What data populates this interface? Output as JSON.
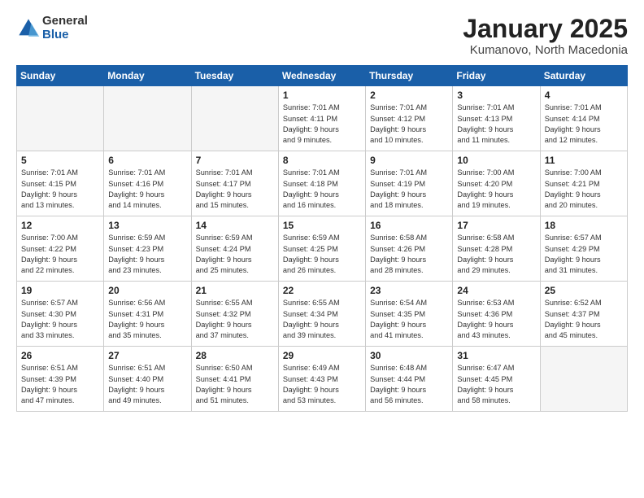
{
  "logo": {
    "general": "General",
    "blue": "Blue"
  },
  "title": "January 2025",
  "subtitle": "Kumanovo, North Macedonia",
  "days_of_week": [
    "Sunday",
    "Monday",
    "Tuesday",
    "Wednesday",
    "Thursday",
    "Friday",
    "Saturday"
  ],
  "weeks": [
    [
      {
        "day": "",
        "info": ""
      },
      {
        "day": "",
        "info": ""
      },
      {
        "day": "",
        "info": ""
      },
      {
        "day": "1",
        "info": "Sunrise: 7:01 AM\nSunset: 4:11 PM\nDaylight: 9 hours\nand 9 minutes."
      },
      {
        "day": "2",
        "info": "Sunrise: 7:01 AM\nSunset: 4:12 PM\nDaylight: 9 hours\nand 10 minutes."
      },
      {
        "day": "3",
        "info": "Sunrise: 7:01 AM\nSunset: 4:13 PM\nDaylight: 9 hours\nand 11 minutes."
      },
      {
        "day": "4",
        "info": "Sunrise: 7:01 AM\nSunset: 4:14 PM\nDaylight: 9 hours\nand 12 minutes."
      }
    ],
    [
      {
        "day": "5",
        "info": "Sunrise: 7:01 AM\nSunset: 4:15 PM\nDaylight: 9 hours\nand 13 minutes."
      },
      {
        "day": "6",
        "info": "Sunrise: 7:01 AM\nSunset: 4:16 PM\nDaylight: 9 hours\nand 14 minutes."
      },
      {
        "day": "7",
        "info": "Sunrise: 7:01 AM\nSunset: 4:17 PM\nDaylight: 9 hours\nand 15 minutes."
      },
      {
        "day": "8",
        "info": "Sunrise: 7:01 AM\nSunset: 4:18 PM\nDaylight: 9 hours\nand 16 minutes."
      },
      {
        "day": "9",
        "info": "Sunrise: 7:01 AM\nSunset: 4:19 PM\nDaylight: 9 hours\nand 18 minutes."
      },
      {
        "day": "10",
        "info": "Sunrise: 7:00 AM\nSunset: 4:20 PM\nDaylight: 9 hours\nand 19 minutes."
      },
      {
        "day": "11",
        "info": "Sunrise: 7:00 AM\nSunset: 4:21 PM\nDaylight: 9 hours\nand 20 minutes."
      }
    ],
    [
      {
        "day": "12",
        "info": "Sunrise: 7:00 AM\nSunset: 4:22 PM\nDaylight: 9 hours\nand 22 minutes."
      },
      {
        "day": "13",
        "info": "Sunrise: 6:59 AM\nSunset: 4:23 PM\nDaylight: 9 hours\nand 23 minutes."
      },
      {
        "day": "14",
        "info": "Sunrise: 6:59 AM\nSunset: 4:24 PM\nDaylight: 9 hours\nand 25 minutes."
      },
      {
        "day": "15",
        "info": "Sunrise: 6:59 AM\nSunset: 4:25 PM\nDaylight: 9 hours\nand 26 minutes."
      },
      {
        "day": "16",
        "info": "Sunrise: 6:58 AM\nSunset: 4:26 PM\nDaylight: 9 hours\nand 28 minutes."
      },
      {
        "day": "17",
        "info": "Sunrise: 6:58 AM\nSunset: 4:28 PM\nDaylight: 9 hours\nand 29 minutes."
      },
      {
        "day": "18",
        "info": "Sunrise: 6:57 AM\nSunset: 4:29 PM\nDaylight: 9 hours\nand 31 minutes."
      }
    ],
    [
      {
        "day": "19",
        "info": "Sunrise: 6:57 AM\nSunset: 4:30 PM\nDaylight: 9 hours\nand 33 minutes."
      },
      {
        "day": "20",
        "info": "Sunrise: 6:56 AM\nSunset: 4:31 PM\nDaylight: 9 hours\nand 35 minutes."
      },
      {
        "day": "21",
        "info": "Sunrise: 6:55 AM\nSunset: 4:32 PM\nDaylight: 9 hours\nand 37 minutes."
      },
      {
        "day": "22",
        "info": "Sunrise: 6:55 AM\nSunset: 4:34 PM\nDaylight: 9 hours\nand 39 minutes."
      },
      {
        "day": "23",
        "info": "Sunrise: 6:54 AM\nSunset: 4:35 PM\nDaylight: 9 hours\nand 41 minutes."
      },
      {
        "day": "24",
        "info": "Sunrise: 6:53 AM\nSunset: 4:36 PM\nDaylight: 9 hours\nand 43 minutes."
      },
      {
        "day": "25",
        "info": "Sunrise: 6:52 AM\nSunset: 4:37 PM\nDaylight: 9 hours\nand 45 minutes."
      }
    ],
    [
      {
        "day": "26",
        "info": "Sunrise: 6:51 AM\nSunset: 4:39 PM\nDaylight: 9 hours\nand 47 minutes."
      },
      {
        "day": "27",
        "info": "Sunrise: 6:51 AM\nSunset: 4:40 PM\nDaylight: 9 hours\nand 49 minutes."
      },
      {
        "day": "28",
        "info": "Sunrise: 6:50 AM\nSunset: 4:41 PM\nDaylight: 9 hours\nand 51 minutes."
      },
      {
        "day": "29",
        "info": "Sunrise: 6:49 AM\nSunset: 4:43 PM\nDaylight: 9 hours\nand 53 minutes."
      },
      {
        "day": "30",
        "info": "Sunrise: 6:48 AM\nSunset: 4:44 PM\nDaylight: 9 hours\nand 56 minutes."
      },
      {
        "day": "31",
        "info": "Sunrise: 6:47 AM\nSunset: 4:45 PM\nDaylight: 9 hours\nand 58 minutes."
      },
      {
        "day": "",
        "info": ""
      }
    ]
  ]
}
